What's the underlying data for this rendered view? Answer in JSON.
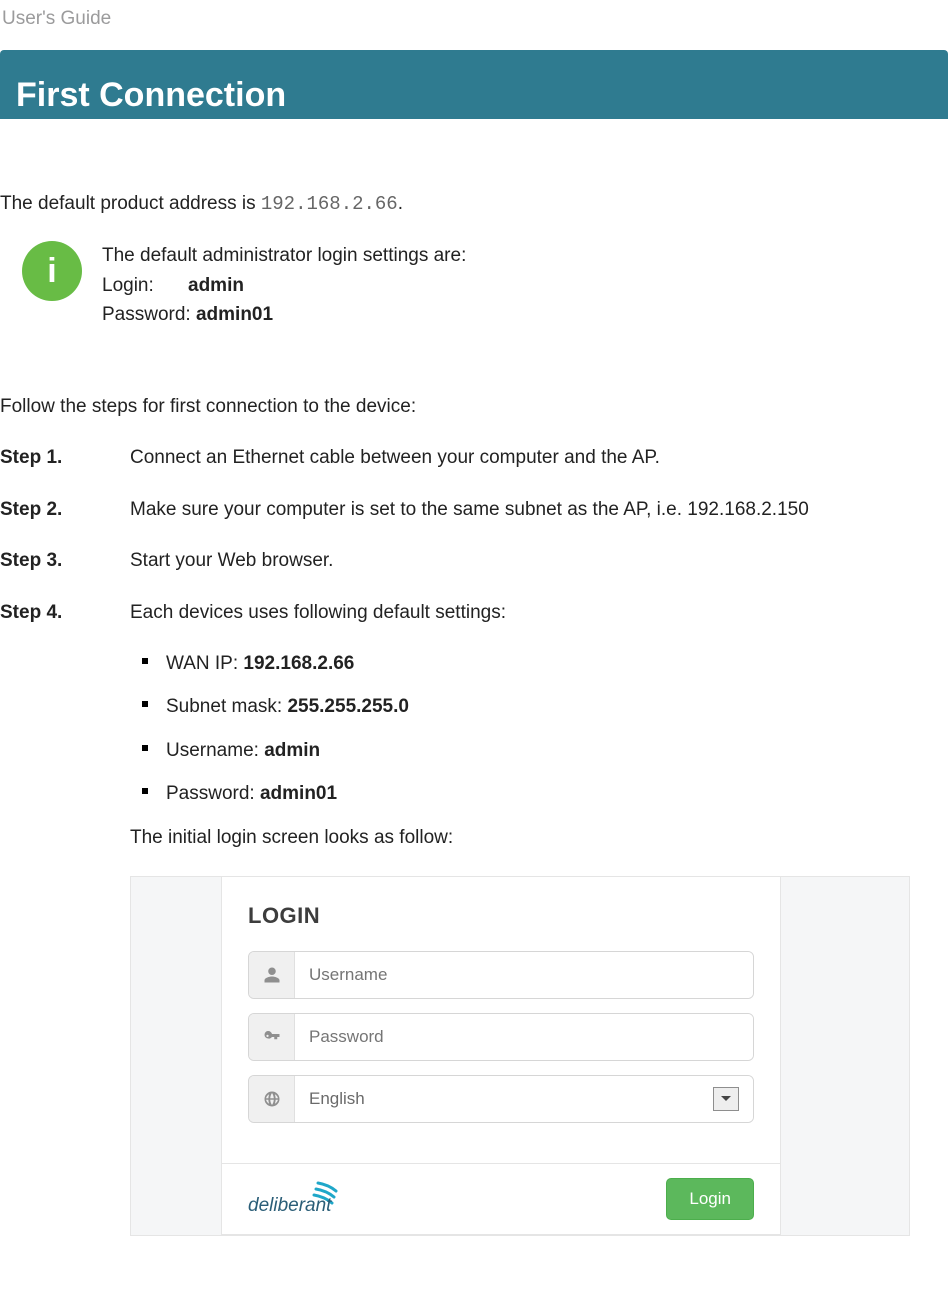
{
  "header": {
    "breadcrumb": "User's Guide",
    "banner_title": "First Connection"
  },
  "intro": {
    "prefix": "The default product address is ",
    "ip": "192.168.2.66",
    "suffix": "."
  },
  "info_box": {
    "line1": "The default administrator login settings are:",
    "login_label": "Login:",
    "login_value": "admin",
    "password_label": "Password:",
    "password_value": "admin01"
  },
  "follow_line": "Follow the steps for first connection to the device:",
  "steps": [
    {
      "label": "Step 1.",
      "text": "Connect an Ethernet cable between your computer and the AP."
    },
    {
      "label": "Step 2.",
      "text": "Make sure your computer is set to the same subnet as the AP, i.e. 192.168.2.150"
    },
    {
      "label": "Step 3.",
      "text": "Start your Web browser."
    },
    {
      "label": "Step 4.",
      "text": "Each devices uses following default settings:"
    }
  ],
  "defaults": {
    "wan_ip_label": "WAN IP: ",
    "wan_ip_value": "192.168.2.66",
    "subnet_label": "Subnet mask: ",
    "subnet_value": "255.255.255.0",
    "username_label": "Username: ",
    "username_value": "admin",
    "password_label": "Password: ",
    "password_value": "admin01"
  },
  "login_intro": "The initial login screen looks as follow:",
  "login_panel": {
    "title": "LOGIN",
    "username_placeholder": "Username",
    "password_placeholder": "Password",
    "language_value": "English",
    "brand_name": "deliberant",
    "login_button": "Login"
  }
}
